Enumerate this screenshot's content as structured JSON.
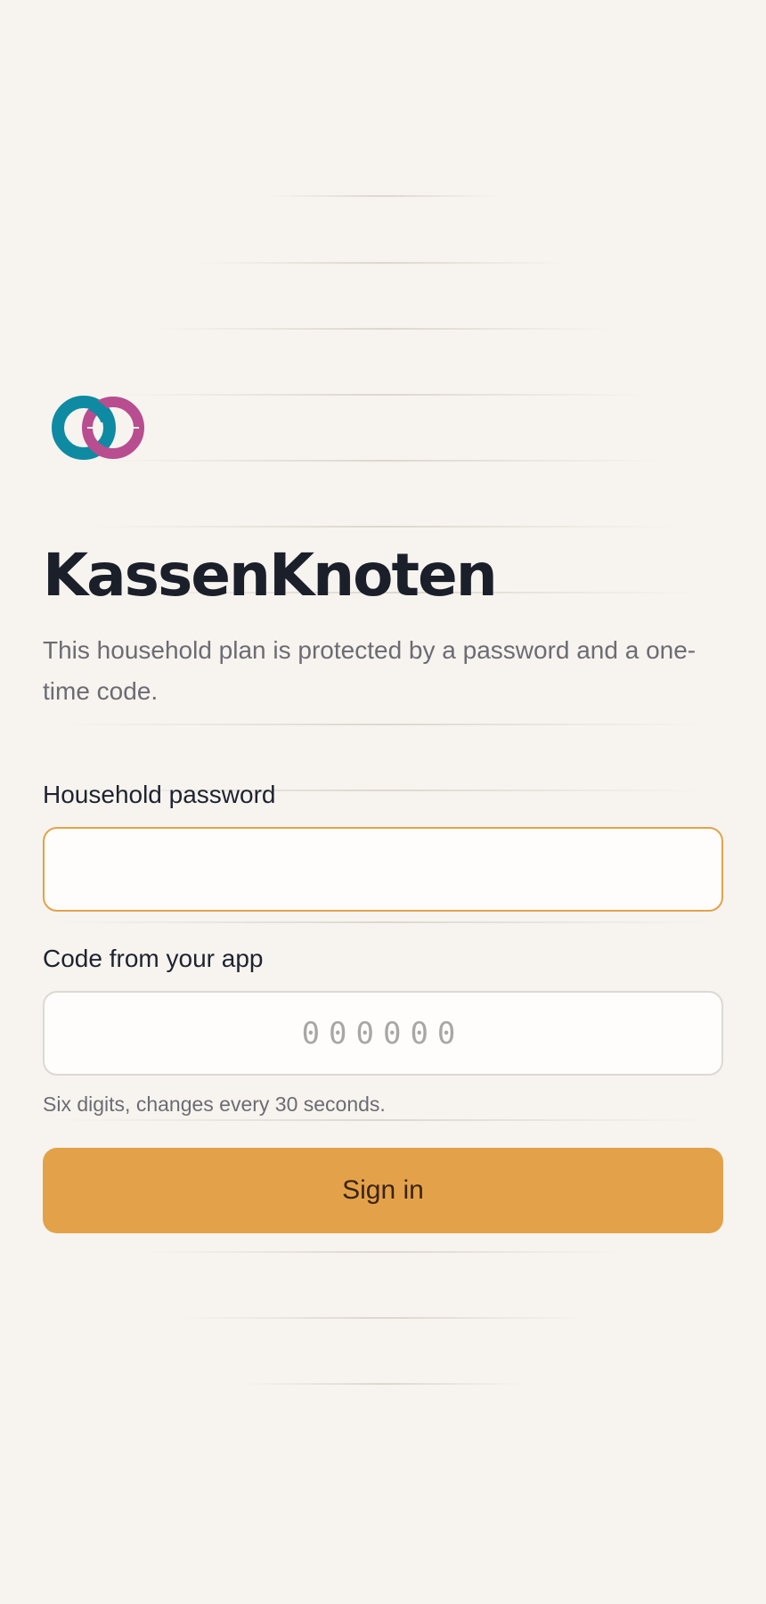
{
  "app": {
    "title": "KassenKnoten",
    "subtitle": "This household plan is protected by a password and a one-time code."
  },
  "form": {
    "password_label": "Household password",
    "password_value": "",
    "code_label": "Code from your app",
    "code_value": "",
    "code_placeholder": "000000",
    "code_hint": "Six digits, changes every 30 seconds.",
    "submit_label": "Sign in"
  },
  "icons": {
    "logo": "interlocking-rings-icon"
  },
  "colors": {
    "background": "#f7f4ef",
    "accent": "#e3a24a",
    "accent_text": "#3b2410",
    "logo_ring_teal": "#0f8aa3",
    "logo_ring_magenta": "#b84d8f",
    "title": "#1b1f2a",
    "muted_text": "#6d6b73"
  }
}
